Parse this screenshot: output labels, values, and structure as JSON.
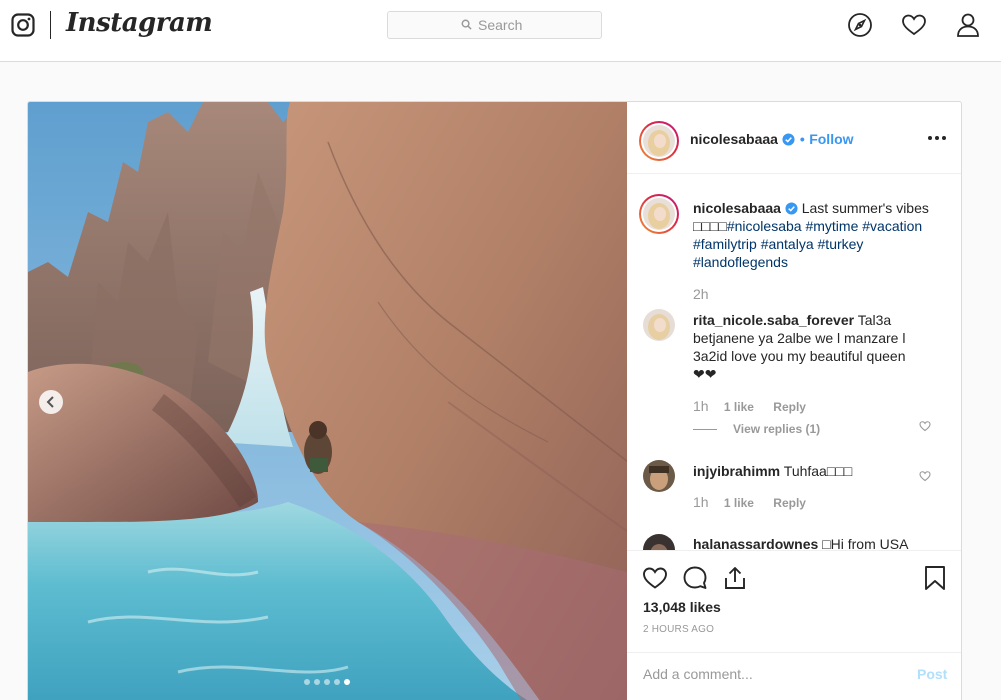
{
  "nav": {
    "logo": "Instagram",
    "search_placeholder": "Search",
    "icons": [
      "camera-icon",
      "compass-icon",
      "heart-icon",
      "profile-icon"
    ]
  },
  "post": {
    "username": "nicolesabaaa",
    "follow_separator": "•",
    "follow_label": "Follow",
    "caption": {
      "username": "nicolesabaaa",
      "text": "Last summer's vibes",
      "line2_prefix": "",
      "tags": [
        "#nicolesaba",
        "#mytime",
        "#vacation",
        "#familytrip",
        "#antalya",
        "#turkey",
        "#landoflegends"
      ],
      "time": "2h"
    },
    "comments": [
      {
        "username": "rita_nicole.saba_forever",
        "text": "Tal3a betjanene ya 2albe we l manzare l 3a2id love you my beautiful queen ❤❤",
        "time": "1h",
        "likes": "1 like",
        "reply": "Reply",
        "view_replies": "View replies (1)"
      },
      {
        "username": "injyibrahimm",
        "text": "Tuhfaa",
        "time": "1h",
        "likes": "1 like",
        "reply": "Reply"
      },
      {
        "username": "halanassardownes",
        "text": "Hi from USA"
      }
    ],
    "likes": "13,048 likes",
    "ago": "2 HOURS AGO",
    "add_comment_placeholder": "Add a comment...",
    "post_label": "Post",
    "carousel": {
      "count": 5,
      "active_index": 4
    }
  },
  "colors": {
    "link": "#3897f0",
    "hashtag": "#003569",
    "muted": "#999999",
    "border": "#dbdbdb"
  }
}
